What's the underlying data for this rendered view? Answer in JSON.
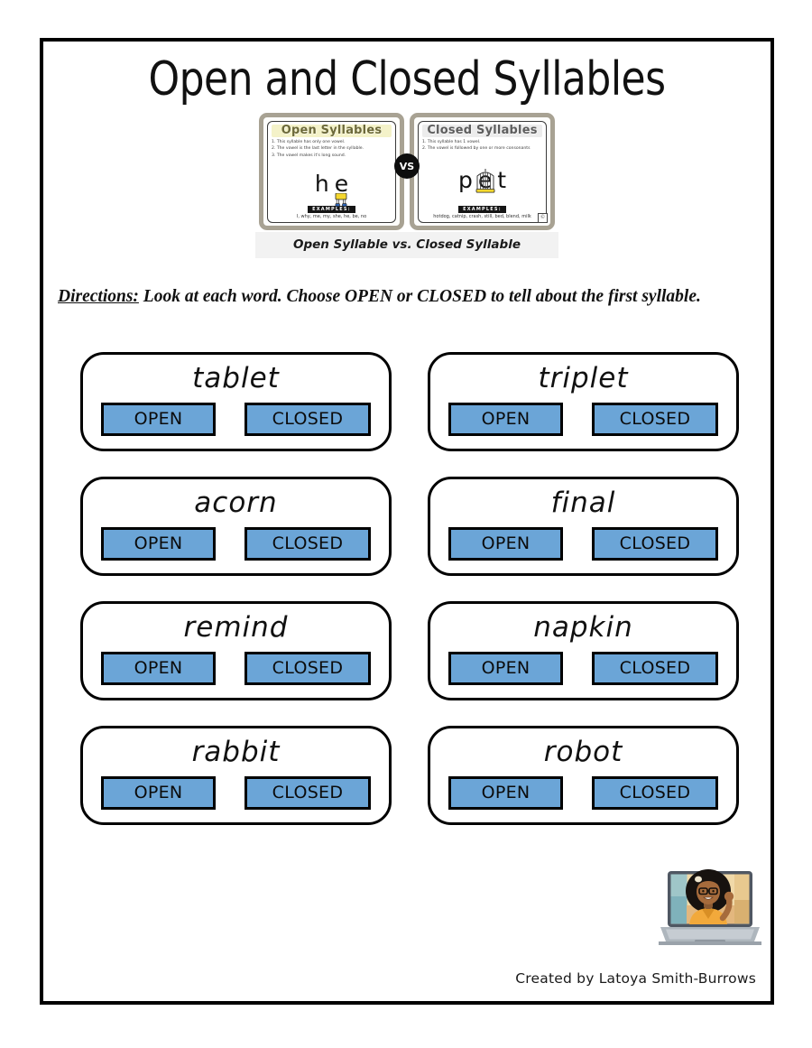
{
  "worksheet": {
    "title": "Open and Closed Syllables",
    "credit": "Created by Latoya Smith-Burrows"
  },
  "poster": {
    "caption": "Open Syllable vs. Closed Syllable",
    "vs_label": "VS",
    "examples_badge": "EXAMPLES:",
    "watermark": "©",
    "open_panel": {
      "heading": "Open Syllables",
      "rules": [
        "1. This syllable has only one vowel.",
        "2. The vowel is the last letter in the syllable.",
        "3. The vowel makes it's long sound."
      ],
      "word_letters": [
        "h",
        "e"
      ],
      "examples": "I, why, me, my, she, he, be, no"
    },
    "closed_panel": {
      "heading": "Closed Syllables",
      "rules": [
        "1. This syllable has 1 vowel.",
        "2. The vowel is followed by one or more consonants"
      ],
      "word_letters": [
        "p",
        "e",
        "t"
      ],
      "examples": "hotdog, catnip, crash, still, bed, blend, milk"
    }
  },
  "directions": {
    "lead": "Directions:",
    "text": "Look at each word.  Choose OPEN or CLOSED to tell about the first syllable."
  },
  "choices": {
    "open_label": "OPEN",
    "closed_label": "CLOSED"
  },
  "words": [
    {
      "word": "tablet"
    },
    {
      "word": "triplet"
    },
    {
      "word": "acorn"
    },
    {
      "word": "final"
    },
    {
      "word": "remind"
    },
    {
      "word": "napkin"
    },
    {
      "word": "rabbit"
    },
    {
      "word": "robot"
    }
  ],
  "colors": {
    "button_fill": "#6ba5d7",
    "border": "#000000",
    "open_heading": "#6d6a3a",
    "closed_heading": "#5d5d5d",
    "highlight_yellow": "#f4f2c9"
  }
}
